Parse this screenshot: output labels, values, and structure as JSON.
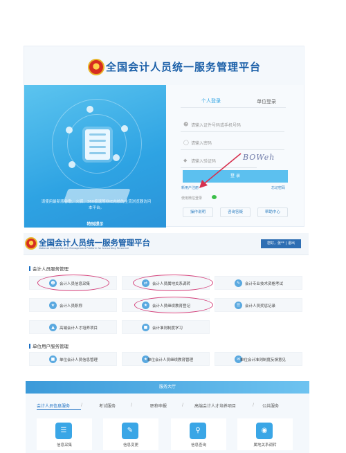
{
  "login_page": {
    "title": "全国会计人员统一服务管理平台",
    "notice_title": "特别提示",
    "notice_text": "请使用最新版谷歌、火狐、360极速等非IE内核的主流浏览器访问本平台。",
    "tabs": [
      "个人登录",
      "单位登录"
    ],
    "fields": [
      {
        "icon": "user-icon",
        "placeholder": "请输入证件号码或手机号码"
      },
      {
        "icon": "lock-icon",
        "placeholder": "请输入密码"
      },
      {
        "icon": "shield-icon",
        "placeholder": "请输入验证码"
      }
    ],
    "captcha_text": "BOWeh",
    "login_button": "登 录",
    "register_link": "新用户注册",
    "forgot_link": "忘记密码",
    "wechat_link": "使用微信登录",
    "bottom_buttons": [
      "操作说明",
      "咨询答疑",
      "帮助中心"
    ],
    "accent_color": "#2ea3e3"
  },
  "portal": {
    "title": "全国会计人员统一服务管理平台",
    "subtitle": "National Unified Service Management Platform for Accounting Personnel",
    "user_label": "您好，张**",
    "logout_label": "退出",
    "sections": [
      {
        "title": "会计人员服务管理",
        "cards": [
          {
            "label": "会计人员信息采集",
            "icon": "user-icon",
            "circled": true
          },
          {
            "label": "会计人员属地关系调转",
            "icon": "transfer-icon",
            "circled": true
          },
          {
            "label": "会计专业技术资格考试",
            "icon": "exam-icon",
            "circled": false
          },
          {
            "label": "会计人员职称",
            "icon": "title-icon",
            "circled": false
          },
          {
            "label": "会计人员继续教育登记",
            "icon": "education-icon",
            "circled": true
          },
          {
            "label": "会计人员奖惩记录",
            "icon": "record-icon",
            "circled": false
          },
          {
            "label": "高端会计人才培养项目",
            "icon": "talent-icon",
            "circled": false
          },
          {
            "label": "会计准则制度学习",
            "icon": "book-icon",
            "circled": false
          }
        ]
      },
      {
        "title": "单位用户服务管理",
        "cards": [
          {
            "label": "单位会计人员信息管理",
            "icon": "org-icon",
            "circled": false
          },
          {
            "label": "单位会计人员继续教育管理",
            "icon": "education-icon",
            "circled": false
          },
          {
            "label": "单位会计准则制度反馈意见",
            "icon": "feedback-icon",
            "circled": false
          }
        ]
      }
    ]
  },
  "service_hall": {
    "title": "服务大厅",
    "tabs": [
      "会计人员信息服务",
      "考试服务",
      "职称申报",
      "高端会计人才培养项目",
      "公共服务"
    ],
    "separator": "/",
    "items": [
      {
        "label": "信息采集",
        "icon": "form-icon"
      },
      {
        "label": "信息变更",
        "icon": "edit-icon"
      },
      {
        "label": "信息查询",
        "icon": "search-icon"
      },
      {
        "label": "属地关系调转",
        "icon": "location-icon"
      }
    ]
  }
}
